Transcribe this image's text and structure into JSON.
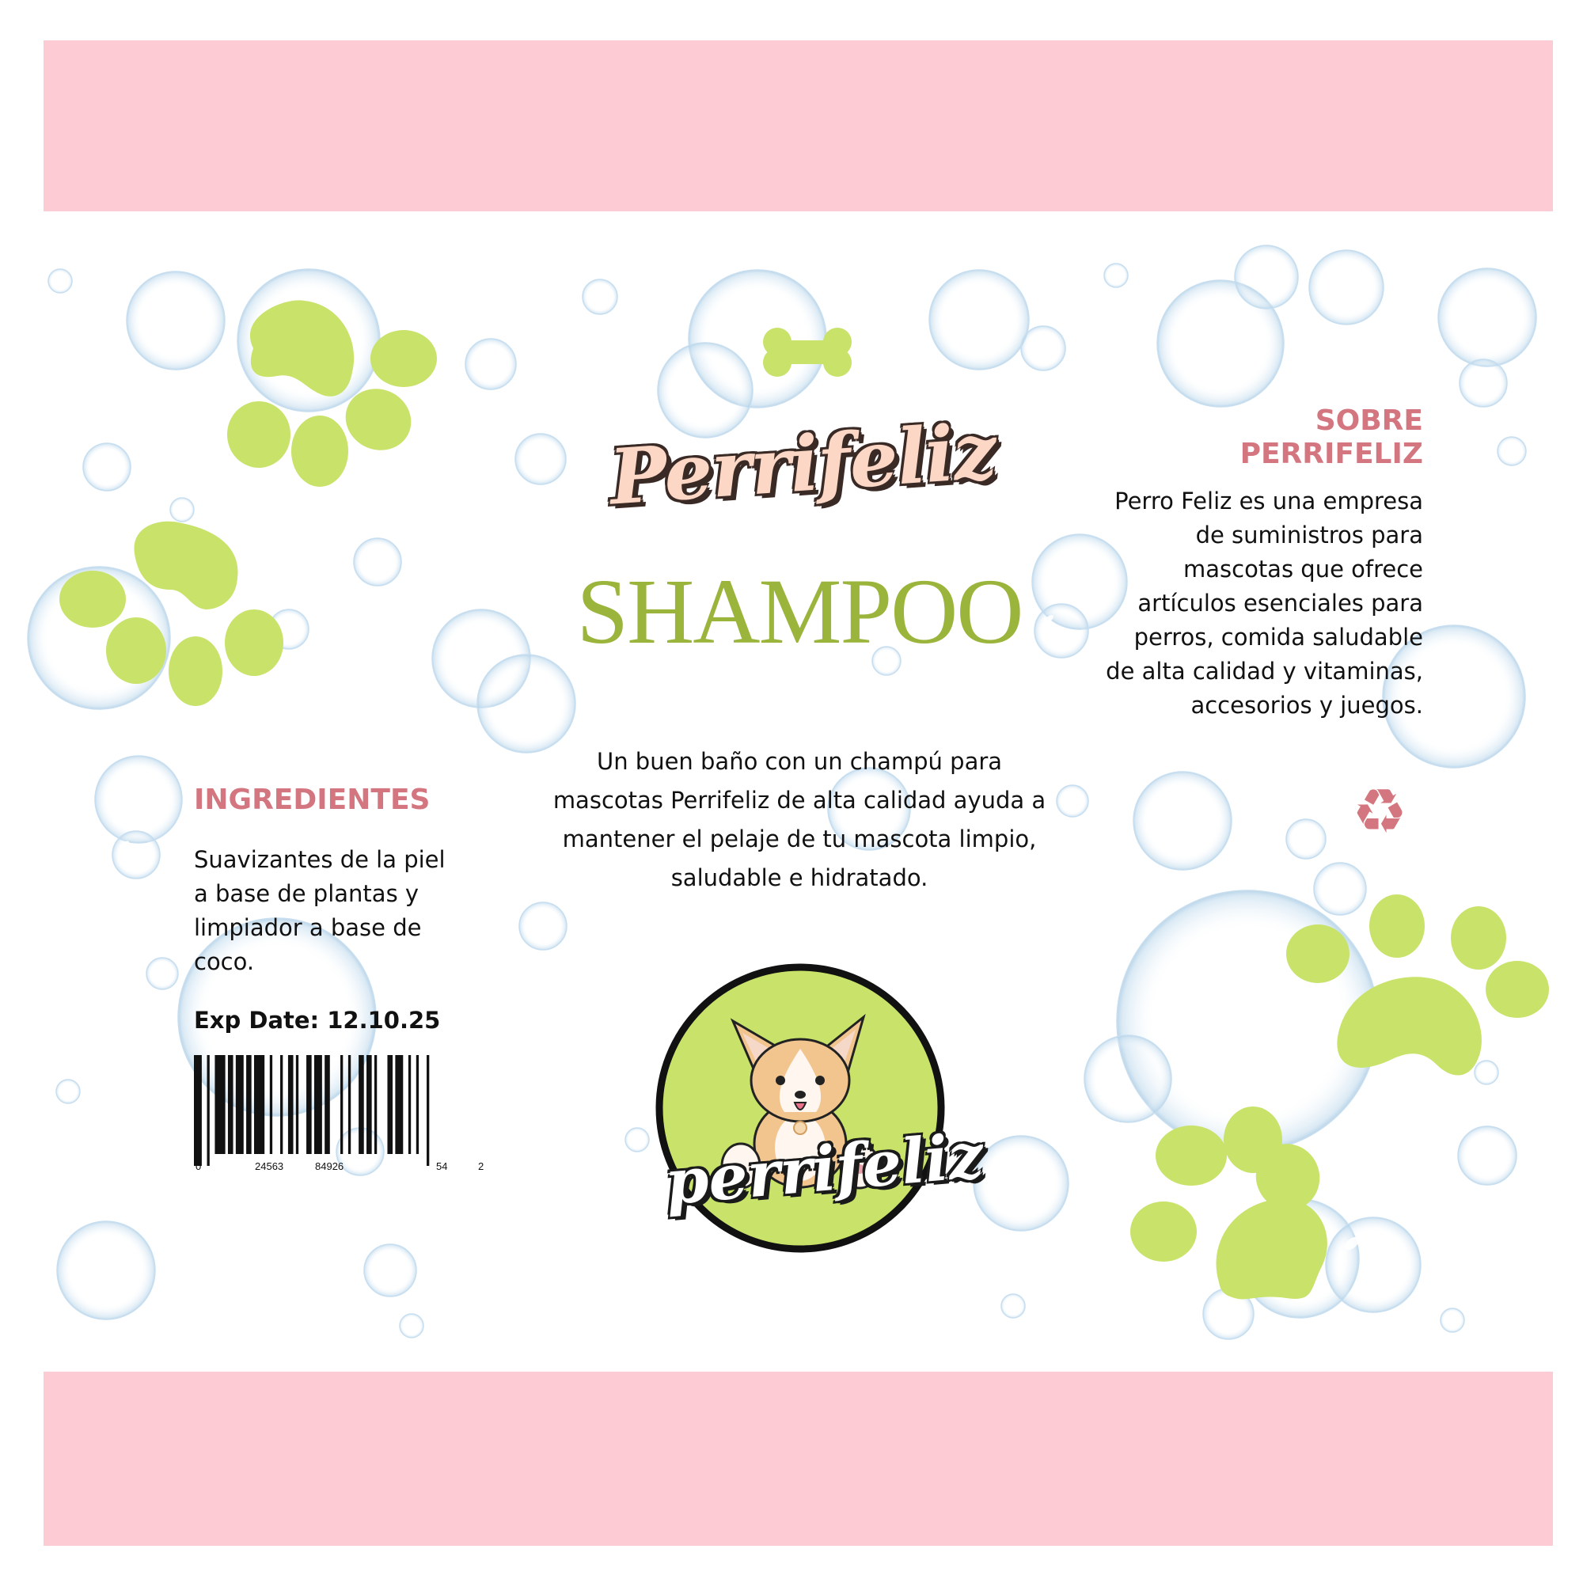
{
  "colors": {
    "band_pink": "#fdcbd3",
    "paw_green": "#c8e26a",
    "accent_pink": "#d4767f",
    "title_green": "#9bb53c",
    "bubble_blue": "#b9d7ea"
  },
  "brand": {
    "title": "Perrifeliz"
  },
  "product": {
    "name": "SHAMPOO"
  },
  "description": "Un buen baño con un champú para mascotas Perrifeliz de alta calidad ayuda a mantener el pelaje de tu mascota limpio, saludable e hidratado.",
  "ingredients": {
    "heading": "INGREDIENTES",
    "text": "Suavizantes de la piel a base de plantas y limpiador a base de coco."
  },
  "exp_date": "Exp Date: 12.10.25",
  "barcode": {
    "digits": [
      "0",
      "24563",
      "84926",
      "54",
      "2"
    ]
  },
  "about": {
    "heading_line1": "SOBRE",
    "heading_line2": "PERRIFELIZ",
    "text": "Perro Feliz es una empresa de suministros para mascotas que ofrece artículos esenciales para perros, comida saludable de alta calidad y vitaminas, accesorios y juegos."
  },
  "logo": {
    "text": "perrifeliz"
  },
  "icons": {
    "recycle": "recycle-icon",
    "bone": "bone-icon",
    "paw": "paw-print-icon",
    "dog": "corgi-dog-icon",
    "bubble": "soap-bubble"
  }
}
